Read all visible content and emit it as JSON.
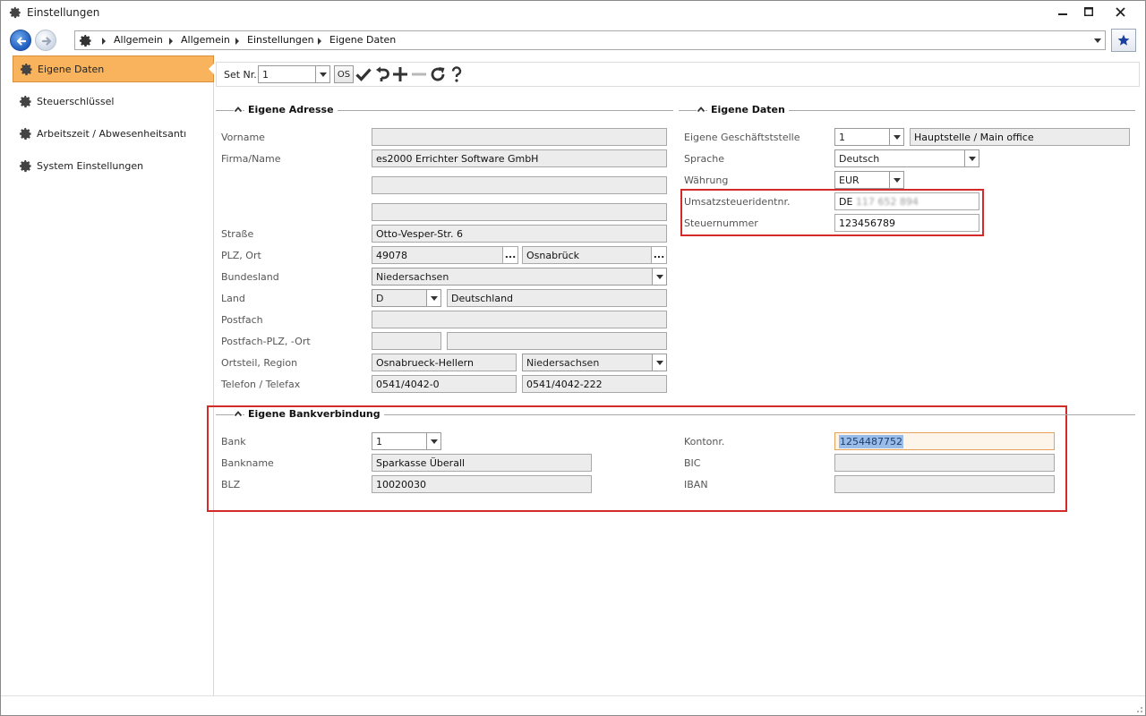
{
  "window": {
    "title": "Einstellungen"
  },
  "breadcrumb": [
    "Allgemein",
    "Allgemein",
    "Einstellungen",
    "Eigene Daten"
  ],
  "sidebar": {
    "items": [
      {
        "label": "Eigene Daten",
        "active": true
      },
      {
        "label": "Steuerschlüssel",
        "active": false
      },
      {
        "label": "Arbeitszeit / Abwesenheitsantı",
        "active": false
      },
      {
        "label": "System Einstellungen",
        "active": false
      }
    ]
  },
  "toolbar": {
    "set_label": "Set Nr.",
    "set_value": "1",
    "os_label": "OS"
  },
  "address": {
    "title": "Eigene Adresse",
    "vorname_label": "Vorname",
    "vorname_value": "",
    "firma_label": "Firma/Name",
    "firma_value1": "es2000 Errichter Software GmbH",
    "firma_value2": "",
    "firma_value3": "",
    "strasse_label": "Straße",
    "strasse_value": "Otto-Vesper-Str. 6",
    "plz_label": "PLZ, Ort",
    "plz_value": "49078",
    "ort_value": "Osnabrück",
    "bundesland_label": "Bundesland",
    "bundesland_value": "Niedersachsen",
    "land_label": "Land",
    "land_code": "D",
    "land_name": "Deutschland",
    "postfach_label": "Postfach",
    "postfach_value": "",
    "postfach_plz_label": "Postfach-PLZ, -Ort",
    "postfach_plz_value": "",
    "postfach_ort_value": "",
    "ortsteil_label": "Ortsteil, Region",
    "ortsteil_value": "Osnabrueck-Hellern",
    "region_value": "Niedersachsen",
    "telefon_label": "Telefon / Telefax",
    "telefon_value": "0541/4042-0",
    "telefax_value": "0541/4042-222"
  },
  "own_data": {
    "title": "Eigene Daten",
    "geschaeftsstelle_label": "Eigene Geschäftststelle",
    "geschaeftsstelle_value": "1",
    "geschaeftsstelle_name": "Hauptstelle / Main office",
    "sprache_label": "Sprache",
    "sprache_value": "Deutsch",
    "waehrung_label": "Währung",
    "waehrung_value": "EUR",
    "ust_label": "Umsatzsteueridentnr.",
    "ust_prefix": "DE",
    "ust_blurred": "117 652 894",
    "steuernr_label": "Steuernummer",
    "steuernr_value": "123456789"
  },
  "bank": {
    "title": "Eigene Bankverbindung",
    "bank_label": "Bank",
    "bank_value": "1",
    "bankname_label": "Bankname",
    "bankname_value": "Sparkasse Überall",
    "blz_label": "BLZ",
    "blz_value": "10020030",
    "kontonr_label": "Kontonr.",
    "kontonr_value": "1254487752",
    "bic_label": "BIC",
    "bic_value": "",
    "iban_label": "IBAN",
    "iban_value": ""
  },
  "colors": {
    "active_item": "#f9b35c",
    "highlight_border": "#d42a2a",
    "selection": "#99bde8"
  }
}
